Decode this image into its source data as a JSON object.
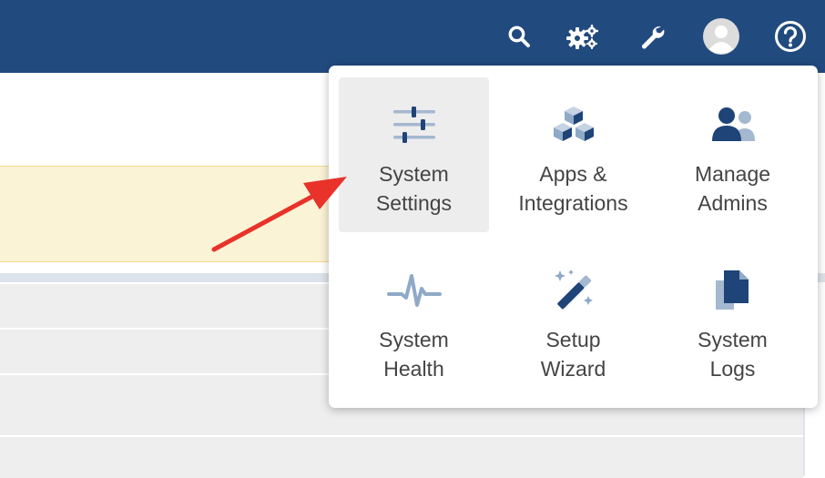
{
  "topbar": {
    "icons": {
      "search": "search-icon",
      "gears": "gears-icon",
      "wrench": "wrench-icon",
      "avatar": "user-avatar",
      "help": "help-icon"
    },
    "color": "#214a7e"
  },
  "menu": {
    "items": [
      {
        "label": "System\nSettings",
        "icon": "sliders-icon",
        "active": true
      },
      {
        "label": "Apps &\nIntegrations",
        "icon": "cubes-icon",
        "active": false
      },
      {
        "label": "Manage\nAdmins",
        "icon": "users-icon",
        "active": false
      },
      {
        "label": "System\nHealth",
        "icon": "pulse-icon",
        "active": false
      },
      {
        "label": "Setup\nWizard",
        "icon": "magic-wand-icon",
        "active": false
      },
      {
        "label": "System\nLogs",
        "icon": "documents-icon",
        "active": false
      }
    ]
  },
  "annotation": {
    "arrow_color": "#e8322a"
  }
}
